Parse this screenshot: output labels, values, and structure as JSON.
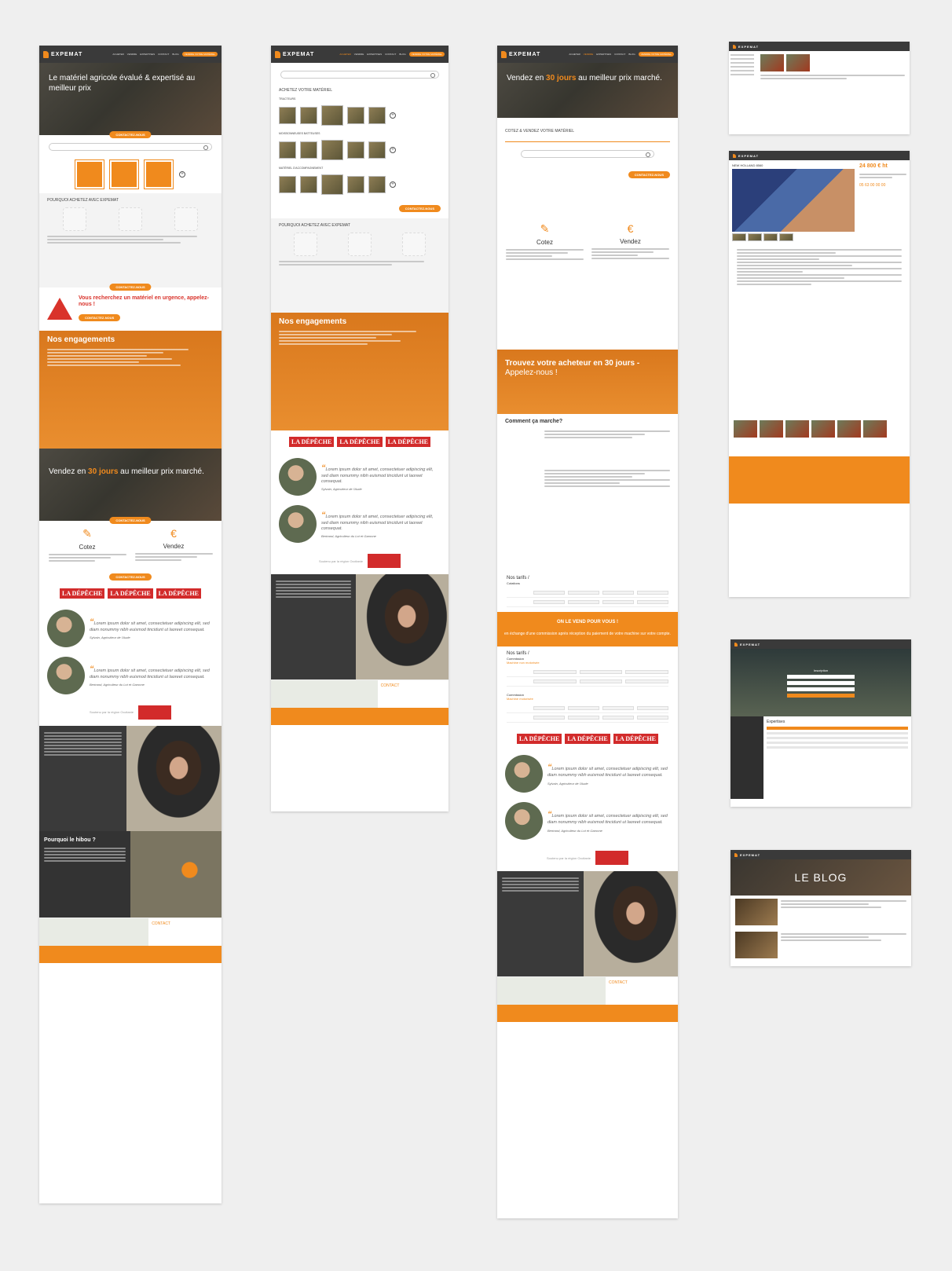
{
  "brand": {
    "name": "EXPEMAT"
  },
  "nav": {
    "items": [
      "ACHETER",
      "VENDRE",
      "EXPERTISES",
      "CONTACT",
      "BLOG"
    ],
    "cta": "VENDRE VOTRE MATÉRIEL"
  },
  "col1": {
    "hero": "Le matériel agricole évalué & expertisé au meilleur prix",
    "contact_btn": "CONTACTEZ-NOUS",
    "search_placeholder": "Rechercher",
    "why_title": "POURQUOI ACHETEZ AVEC EXPEMAT",
    "urgent": "Vous recherchez un matériel en urgence, appelez-nous !",
    "urgent_btn": "Contactez-nous",
    "engagements_title": "Nos engagements",
    "sell_hero_pre": "Vendez en ",
    "sell_hero_hl": "30 jours",
    "sell_hero_post": " au meilleur prix marché.",
    "cotez": "Cotez",
    "vendez": "Vendez",
    "press": [
      "LA DÉPÊCHE",
      "LA DÉPÊCHE",
      "LA DÉPÊCHE"
    ],
    "testimonials": [
      {
        "text": "Lorem ipsum dolor sit amet, consectetuer adipiscing elit, sed diam nonummy nibh euismod tincidunt ut laoreet consequat.",
        "author": "Sylvain, Agriculteur de l'Aude"
      },
      {
        "text": "Lorem ipsum dolor sit amet, consectetuer adipiscing elit, sed diam nonummy nibh euismod tincidunt ut laoreet consequat.",
        "author": "Bertrand, Agriculteur du Lot et Garonne"
      }
    ],
    "region": "Soutenu par la région Occitanie",
    "owl_title": "Pourquoi le hibou ?",
    "contact": "CONTACT"
  },
  "col2": {
    "buy_title": "ACHETEZ VOTRE MATÉRIEL",
    "cat1": "TRACTEURS",
    "cat2": "MOISSONNEUSES BATTEUSES",
    "cat3": "MATÉRIEL D'ACCOMPAGNEMENT",
    "why_title": "POURQUOI ACHETEZ AVEC EXPEMAT",
    "engagements_title": "Nos engagements",
    "contact": "CONTACT"
  },
  "col3": {
    "hero_pre": "Vendez en ",
    "hero_hl": "30 jours",
    "hero_post": " au meilleur prix marché.",
    "cote_title": "COTEZ & VENDEZ VOTRE MATÉRIEL",
    "find_pre": "Trouvez votre acheteur en 30 jours - ",
    "find_post": "Appelez-nous !",
    "how": "Comment ça marche?",
    "tarifs1": "Nos tarifs /",
    "tarifs1_sub": "Cotations",
    "oncta_title": "ON LE VEND POUR VOUS !",
    "oncta_sub": "en échange d'une commission après réception du paiement de votre machine sur votre compte.",
    "tarifs2": "Nos tarifs /",
    "tarifs2_sub": "Commission",
    "tarifs2_sub2": "Machine non motorisée",
    "comm2": "Commission",
    "comm2_sub": "Machine motorisée",
    "contact": "CONTACT"
  },
  "col4": {
    "listing_title": "NEW HOLLAND 8560",
    "price": "24 800 € ht",
    "phone": "05 63 00 00 00",
    "login_title": "Inscription",
    "dash_title": "Expertises",
    "blog_title": "LE BLOG"
  },
  "colors": {
    "accent": "#f08a1d",
    "dark": "#3a3a3a",
    "press": "#d22b2b"
  }
}
